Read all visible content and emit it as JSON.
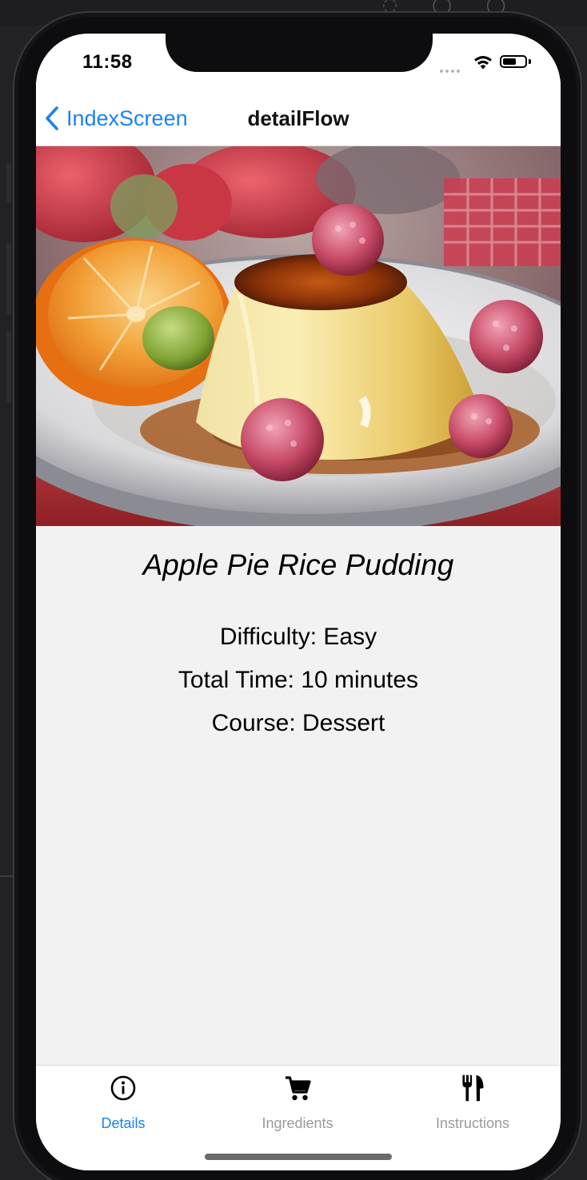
{
  "status_bar": {
    "time": "11:58",
    "battery_level": 0.6
  },
  "nav": {
    "back_label": "IndexScreen",
    "title": "detailFlow"
  },
  "hero": {
    "description_icon": "dessert-photo"
  },
  "recipe": {
    "title": "Apple Pie Rice Pudding",
    "difficulty": "Difficulty: Easy",
    "total_time": "Total Time: 10 minutes",
    "course": "Course: Dessert"
  },
  "tabs": [
    {
      "label": "Details",
      "icon": "info-icon",
      "active": true
    },
    {
      "label": "Ingredients",
      "icon": "cart-icon",
      "active": false
    },
    {
      "label": "Instructions",
      "icon": "utensils-icon",
      "active": false
    }
  ],
  "colors": {
    "accent": "#1a82f4",
    "inactive_tab": "#9a9a9a",
    "content_bg": "#f2f2f2"
  }
}
